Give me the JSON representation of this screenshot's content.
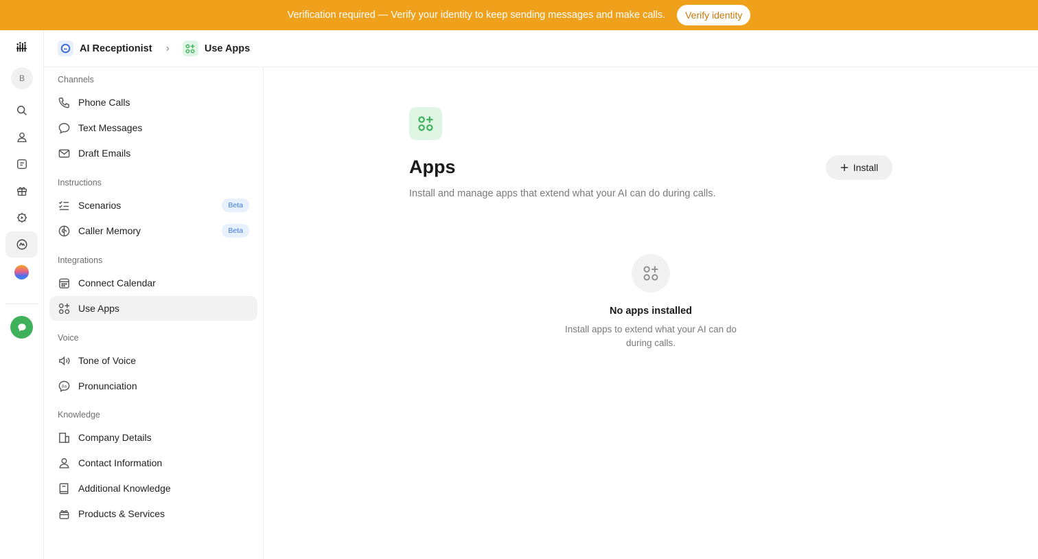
{
  "banner": {
    "text": "Verification required — Verify your identity to keep sending messages and make calls.",
    "button_label": "Verify identity"
  },
  "rail": {
    "avatar_letter": "B",
    "icons": [
      "logo-icon",
      "search-icon",
      "contacts-icon",
      "inbox-icon",
      "gift-icon",
      "settings-icon",
      "ai-receptionist-icon",
      "gradient-orb-icon",
      "chat-icon"
    ]
  },
  "breadcrumb": {
    "first": "AI Receptionist",
    "second": "Use Apps"
  },
  "sidebar": {
    "sections": [
      {
        "label": "Channels",
        "items": [
          {
            "label": "Phone Calls",
            "icon": "phone-icon"
          },
          {
            "label": "Text Messages",
            "icon": "message-icon"
          },
          {
            "label": "Draft Emails",
            "icon": "mail-icon"
          }
        ]
      },
      {
        "label": "Instructions",
        "items": [
          {
            "label": "Scenarios",
            "icon": "checklist-icon",
            "badge": "Beta"
          },
          {
            "label": "Caller Memory",
            "icon": "brain-icon",
            "badge": "Beta"
          }
        ]
      },
      {
        "label": "Integrations",
        "items": [
          {
            "label": "Connect Calendar",
            "icon": "calendar-icon"
          },
          {
            "label": "Use Apps",
            "icon": "apps-icon",
            "active": true
          }
        ]
      },
      {
        "label": "Voice",
        "items": [
          {
            "label": "Tone of Voice",
            "icon": "speaker-icon"
          },
          {
            "label": "Pronunciation",
            "icon": "pronunciation-icon"
          }
        ]
      },
      {
        "label": "Knowledge",
        "items": [
          {
            "label": "Company Details",
            "icon": "building-icon"
          },
          {
            "label": "Contact Information",
            "icon": "person-icon"
          },
          {
            "label": "Additional Knowledge",
            "icon": "book-icon"
          },
          {
            "label": "Products & Services",
            "icon": "box-icon"
          }
        ]
      }
    ]
  },
  "main": {
    "title": "Apps",
    "subtitle": "Install and manage apps that extend what your AI can do during calls.",
    "install_label": "Install",
    "empty_title": "No apps installed",
    "empty_desc": "Install apps to extend what your AI can do during calls."
  },
  "colors": {
    "banner": "#f0a11b",
    "accent_green": "#3fb15b",
    "beta_bg": "#e7f0fd",
    "beta_text": "#3f7ae0"
  }
}
